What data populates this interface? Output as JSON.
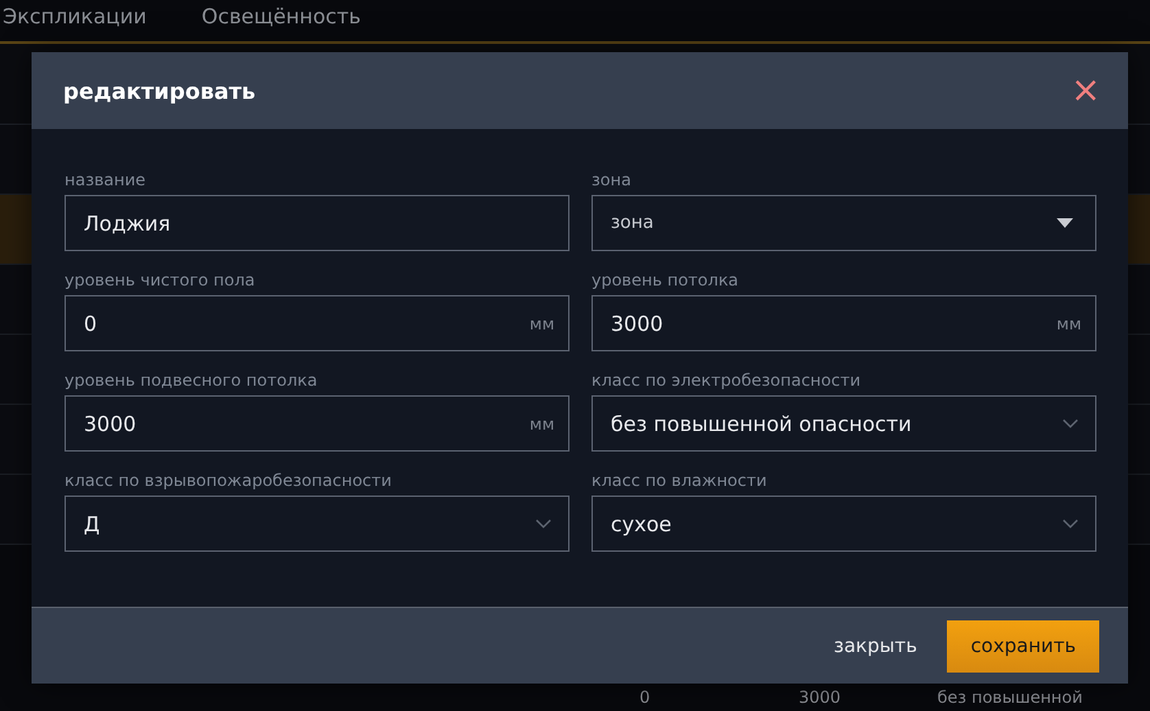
{
  "tabs": [
    {
      "label": "Экспликации",
      "selected": false
    },
    {
      "label": "Освещённость",
      "selected": false
    }
  ],
  "background_row": [
    "0",
    "3000",
    "без повышенной"
  ],
  "dialog": {
    "title": "редактировать",
    "close": "×",
    "fields": [
      {
        "kind": "text",
        "label": "название",
        "value": "Лоджия"
      },
      {
        "kind": "combo",
        "label": "зона",
        "placeholder": "зона"
      },
      {
        "kind": "unit",
        "label": "уровень чистого пола",
        "value": "0",
        "unit": "мм"
      },
      {
        "kind": "unit",
        "label": "уровень потолка",
        "value": "3000",
        "unit": "мм"
      },
      {
        "kind": "unit",
        "label": "уровень подвесного потолка",
        "value": "3000",
        "unit": "мм"
      },
      {
        "kind": "select",
        "label": "класс по электробезопасности",
        "value": "без повышенной опасности"
      },
      {
        "kind": "select",
        "label": "класс по взрывопожаробезопасности",
        "value": "Д"
      },
      {
        "kind": "select",
        "label": "класс по влажности",
        "value": "сухое"
      }
    ],
    "buttons": [
      {
        "kind": "text",
        "label": "закрыть"
      },
      {
        "kind": "primary",
        "label": "сохранить"
      }
    ]
  }
}
